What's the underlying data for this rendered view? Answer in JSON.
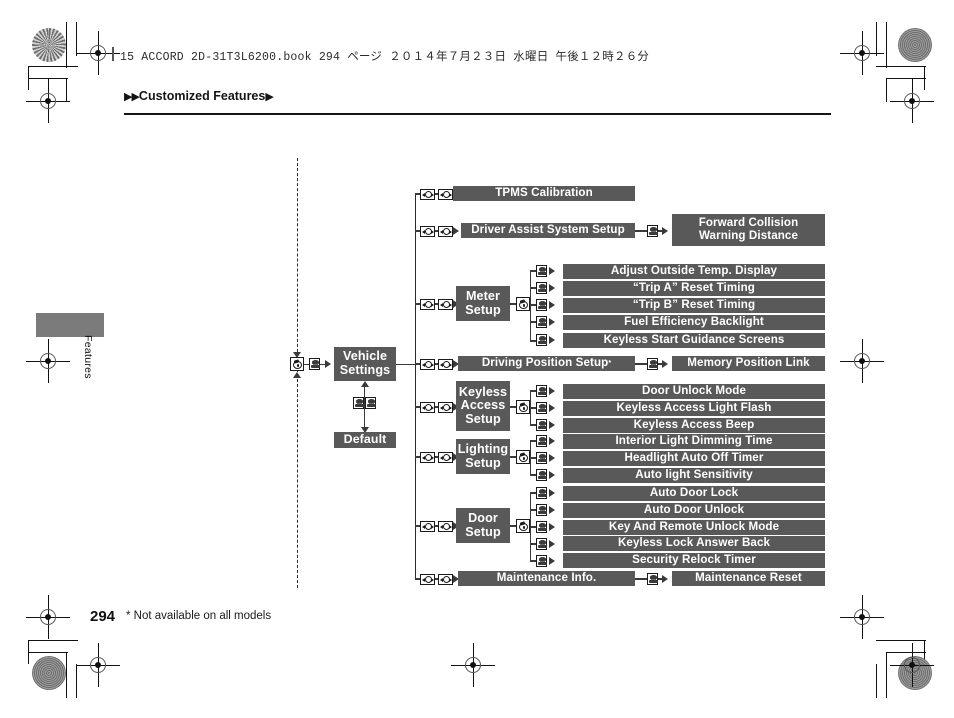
{
  "print": {
    "header_text": "15 ACCORD 2D-31T3L6200.book   294 ページ   ２０１４年７月２３日   水曜日   午後１２時２６分",
    "breadcrumb": "Customized Features",
    "side_tab_label": "Features",
    "page_number": "294",
    "footnote": "* Not available on all models",
    "colors": {
      "box_fill": "#595959",
      "box_text": "#ffffff",
      "line": "#2a2a2a",
      "tab_fill": "#7b7b7b"
    }
  },
  "icons": {
    "wide_pair": "rotate-select-icon",
    "enter_button": "enter-button-icon",
    "dial": "selector-dial-icon",
    "arrow": "arrow-icon"
  },
  "chart_data": {
    "type": "diagram",
    "title": "Vehicle Settings menu tree",
    "root": {
      "label": "Vehicle Settings"
    },
    "default_node": {
      "label": "Default"
    },
    "branches": [
      {
        "label": "TPMS Calibration",
        "kind": "bar",
        "children": []
      },
      {
        "label": "Driver Assist System Setup",
        "kind": "bar",
        "children": [
          "Forward Collision\nWarning Distance"
        ]
      },
      {
        "label": "Meter Setup",
        "kind": "node",
        "children": [
          "Adjust Outside Temp. Display",
          "“Trip A” Reset Timing",
          "“Trip B” Reset Timing",
          "Fuel Efficiency Backlight",
          "Keyless Start Guidance Screens"
        ]
      },
      {
        "label": "Driving Position Setup",
        "kind": "bar",
        "footnote_mark": "*",
        "children": [
          "Memory Position Link"
        ]
      },
      {
        "label": "Keyless Access Setup",
        "kind": "node",
        "children": [
          "Door Unlock Mode",
          "Keyless Access Light Flash",
          "Keyless Access Beep"
        ]
      },
      {
        "label": "Lighting Setup",
        "kind": "node",
        "children": [
          "Interior Light Dimming Time",
          "Headlight Auto Off Timer",
          "Auto light Sensitivity"
        ]
      },
      {
        "label": "Door Setup",
        "kind": "node",
        "children": [
          "Auto Door Lock",
          "Auto Door Unlock",
          "Key And Remote Unlock Mode",
          "Keyless Lock Answer Back",
          "Security Relock Timer"
        ]
      },
      {
        "label": "Maintenance Info.",
        "kind": "bar",
        "children": [
          "Maintenance Reset"
        ]
      }
    ]
  },
  "boxes": {
    "vehicle_settings": "Vehicle\nSettings",
    "default": "Default",
    "tpms": "TPMS Calibration",
    "driver_assist": "Driver Assist System Setup",
    "fcw": "Forward Collision\nWarning Distance",
    "meter_setup": "Meter\nSetup",
    "meter_1": "Adjust Outside Temp. Display",
    "meter_2": "“Trip A” Reset Timing",
    "meter_3": "“Trip B” Reset Timing",
    "meter_4": "Fuel Efficiency Backlight",
    "meter_5": "Keyless Start Guidance Screens",
    "driving_position": "Driving Position Setup",
    "driving_position_mark": "*",
    "memory_link": "Memory Position Link",
    "keyless_setup": "Keyless\nAccess\nSetup",
    "keyless_1": "Door Unlock Mode",
    "keyless_2": "Keyless Access Light Flash",
    "keyless_3": "Keyless Access Beep",
    "lighting_setup": "Lighting\nSetup",
    "lighting_1": "Interior Light Dimming Time",
    "lighting_2": "Headlight Auto Off Timer",
    "lighting_3": "Auto light Sensitivity",
    "door_setup": "Door\nSetup",
    "door_1": "Auto Door Lock",
    "door_2": "Auto Door Unlock",
    "door_3": "Key And Remote Unlock Mode",
    "door_4": "Keyless Lock Answer Back",
    "door_5": "Security Relock Timer",
    "maintenance": "Maintenance Info.",
    "maintenance_reset": "Maintenance Reset"
  }
}
